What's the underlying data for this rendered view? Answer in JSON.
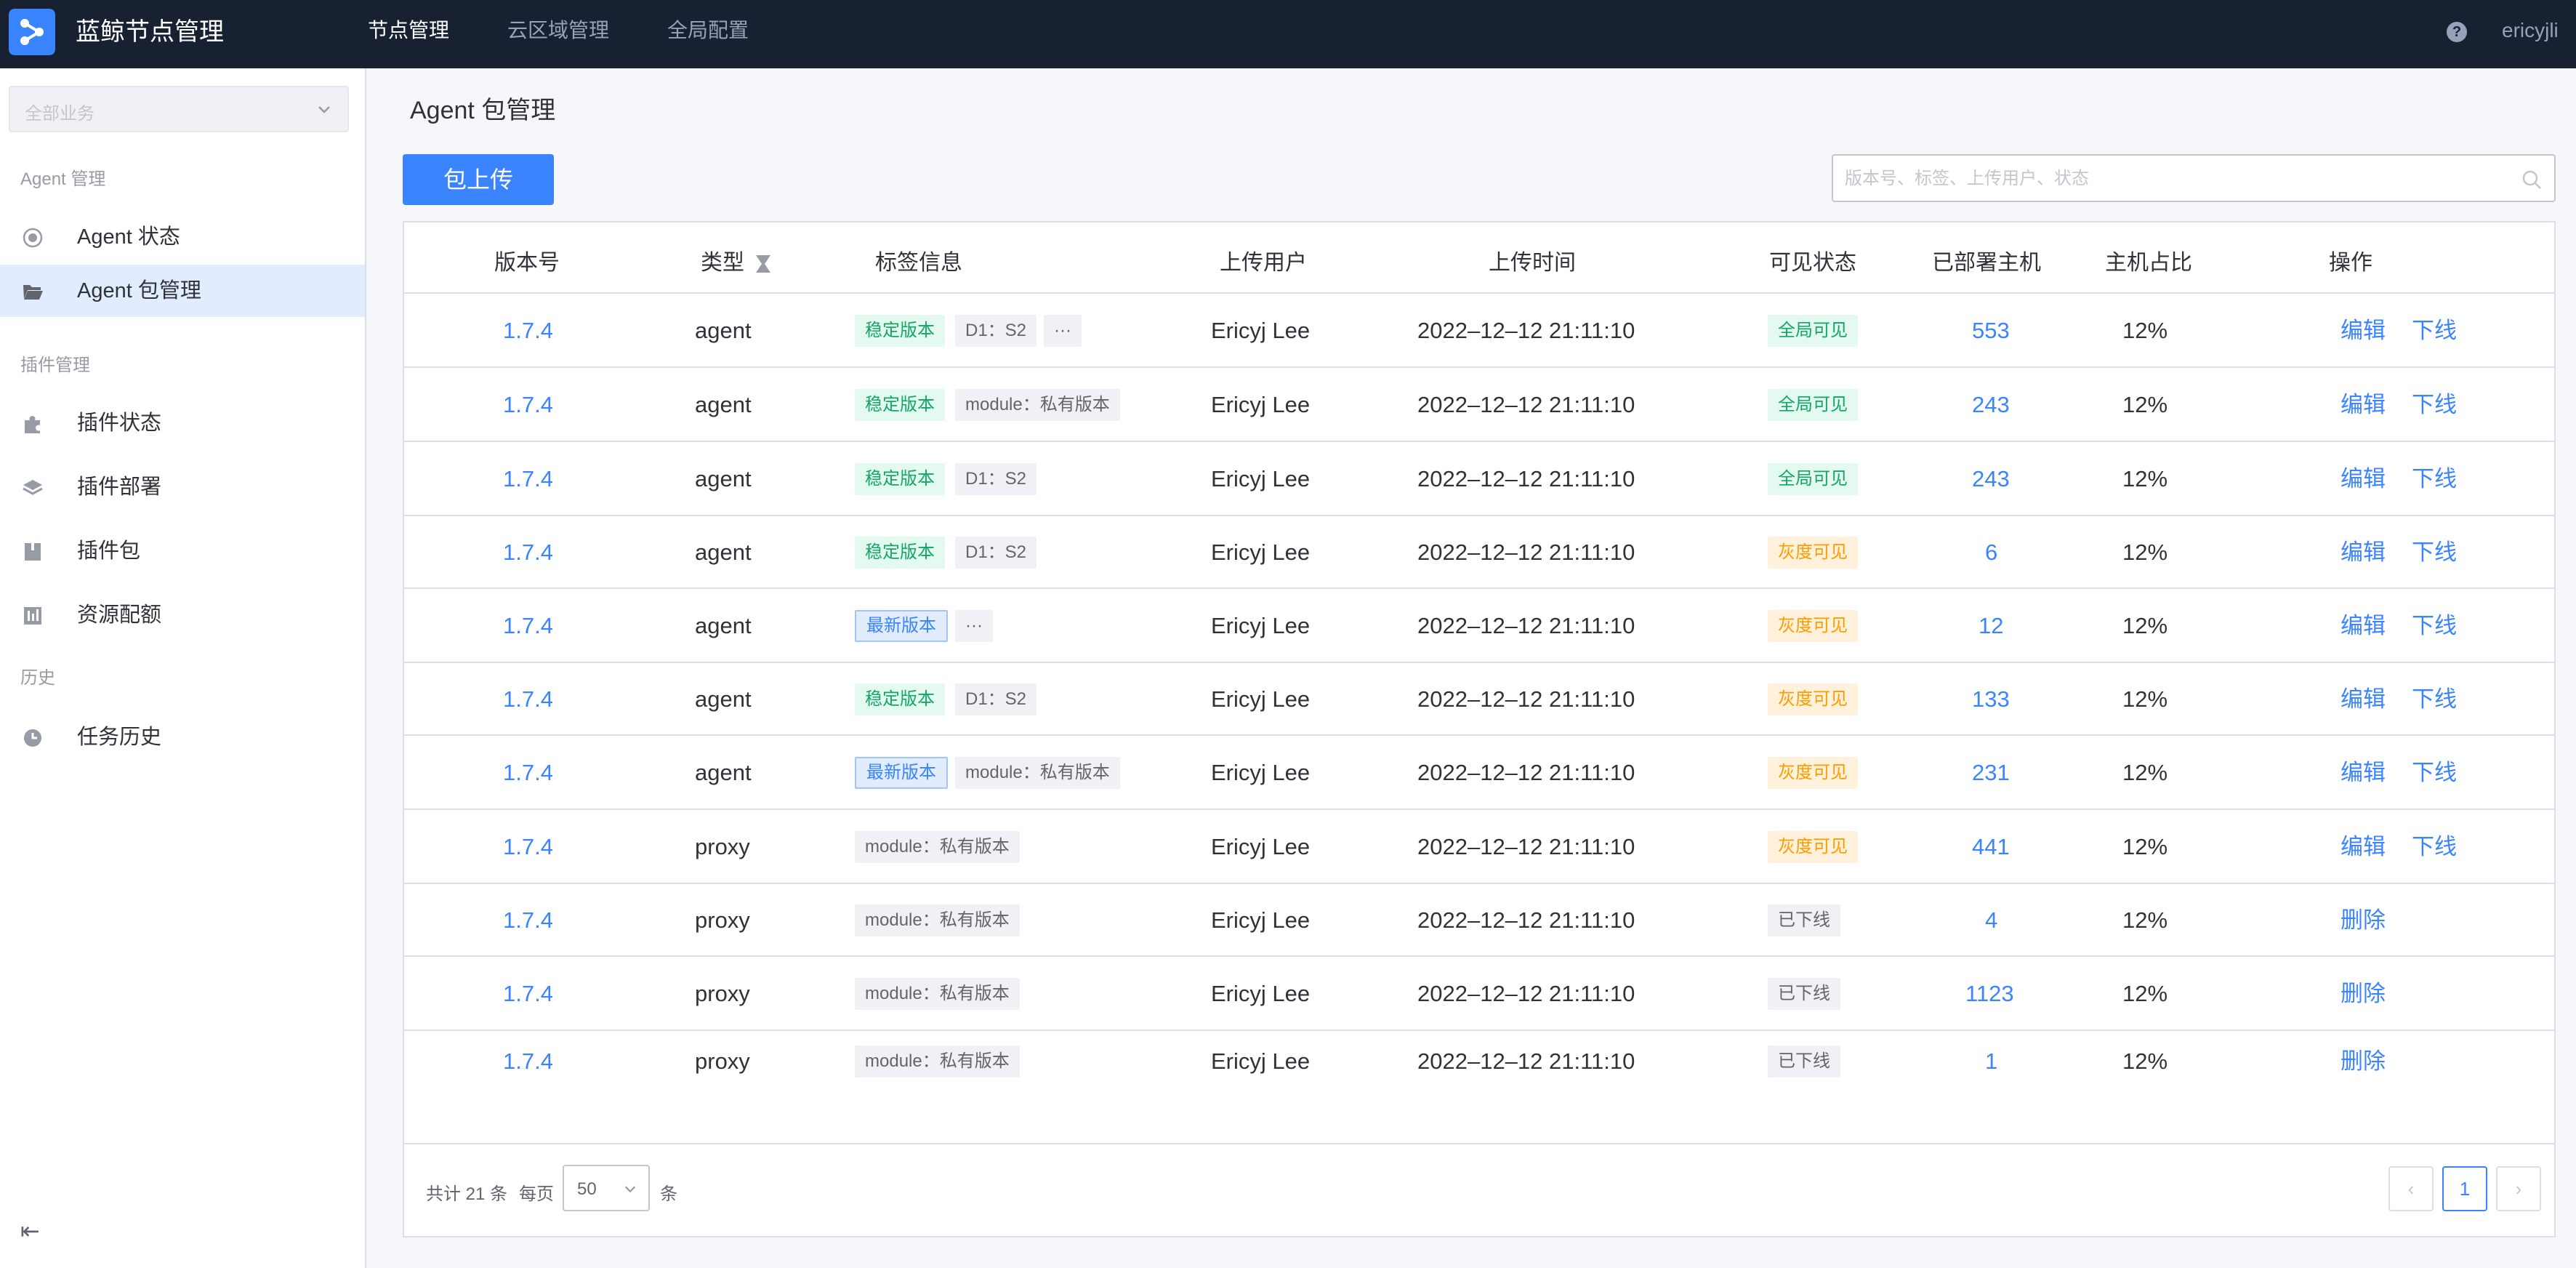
{
  "header": {
    "app_title": "蓝鲸节点管理",
    "nav": [
      "节点管理",
      "云区域管理",
      "全局配置"
    ],
    "username": "ericyjli",
    "help_icon": "help-icon"
  },
  "sidebar": {
    "business_select": "全部业务",
    "groups": [
      {
        "title": "Agent 管理"
      },
      {
        "title": "插件管理"
      },
      {
        "title": "历史"
      }
    ],
    "items": [
      {
        "label": "Agent 状态",
        "icon": "radio-icon"
      },
      {
        "label": "Agent 包管理",
        "icon": "folder-open-icon"
      },
      {
        "label": "插件状态",
        "icon": "puzzle-icon"
      },
      {
        "label": "插件部署",
        "icon": "layers-icon"
      },
      {
        "label": "插件包",
        "icon": "package-icon"
      },
      {
        "label": "资源配额",
        "icon": "quota-icon"
      },
      {
        "label": "任务历史",
        "icon": "clock-icon"
      }
    ]
  },
  "main": {
    "page_title": "Agent 包管理",
    "upload_label": "包上传",
    "search_placeholder": "版本号、标签、上传用户、状态",
    "columns": [
      "版本号",
      "类型",
      "标签信息",
      "上传用户",
      "上传时间",
      "可见状态",
      "已部署主机",
      "主机占比",
      "操作"
    ],
    "rows": [
      {
        "version": "1.7.4",
        "type": "agent",
        "tags": [
          {
            "text": "稳定版本",
            "style": "green"
          },
          {
            "text": "D1：S2",
            "style": "gray"
          },
          {
            "text": "···",
            "style": "gray"
          }
        ],
        "user": "Ericyj Lee",
        "time": "2022–12–12 21:11:10",
        "status": "全局可见",
        "status_style": "green",
        "hosts": "553",
        "ratio": "12%",
        "actions": [
          "编辑",
          "下线"
        ]
      },
      {
        "version": "1.7.4",
        "type": "agent",
        "tags": [
          {
            "text": "稳定版本",
            "style": "green"
          },
          {
            "text": "module：私有版本",
            "style": "gray"
          }
        ],
        "user": "Ericyj Lee",
        "time": "2022–12–12 21:11:10",
        "status": "全局可见",
        "status_style": "green",
        "hosts": "243",
        "ratio": "12%",
        "actions": [
          "编辑",
          "下线"
        ]
      },
      {
        "version": "1.7.4",
        "type": "agent",
        "tags": [
          {
            "text": "稳定版本",
            "style": "green"
          },
          {
            "text": "D1：S2",
            "style": "gray"
          }
        ],
        "user": "Ericyj Lee",
        "time": "2022–12–12 21:11:10",
        "status": "全局可见",
        "status_style": "green",
        "hosts": "243",
        "ratio": "12%",
        "actions": [
          "编辑",
          "下线"
        ]
      },
      {
        "version": "1.7.4",
        "type": "agent",
        "tags": [
          {
            "text": "稳定版本",
            "style": "green"
          },
          {
            "text": "D1：S2",
            "style": "gray"
          }
        ],
        "user": "Ericyj Lee",
        "time": "2022–12–12 21:11:10",
        "status": "灰度可见",
        "status_style": "orange",
        "hosts": "6",
        "ratio": "12%",
        "actions": [
          "编辑",
          "下线"
        ]
      },
      {
        "version": "1.7.4",
        "type": "agent",
        "tags": [
          {
            "text": "最新版本",
            "style": "blue"
          },
          {
            "text": "···",
            "style": "gray"
          }
        ],
        "user": "Ericyj Lee",
        "time": "2022–12–12 21:11:10",
        "status": "灰度可见",
        "status_style": "orange",
        "hosts": "12",
        "ratio": "12%",
        "actions": [
          "编辑",
          "下线"
        ]
      },
      {
        "version": "1.7.4",
        "type": "agent",
        "tags": [
          {
            "text": "稳定版本",
            "style": "green"
          },
          {
            "text": "D1：S2",
            "style": "gray"
          }
        ],
        "user": "Ericyj Lee",
        "time": "2022–12–12 21:11:10",
        "status": "灰度可见",
        "status_style": "orange",
        "hosts": "133",
        "ratio": "12%",
        "actions": [
          "编辑",
          "下线"
        ]
      },
      {
        "version": "1.7.4",
        "type": "agent",
        "tags": [
          {
            "text": "最新版本",
            "style": "blue"
          },
          {
            "text": "module：私有版本",
            "style": "gray"
          }
        ],
        "user": "Ericyj Lee",
        "time": "2022–12–12 21:11:10",
        "status": "灰度可见",
        "status_style": "orange",
        "hosts": "231",
        "ratio": "12%",
        "actions": [
          "编辑",
          "下线"
        ]
      },
      {
        "version": "1.7.4",
        "type": "proxy",
        "tags": [
          {
            "text": "module：私有版本",
            "style": "gray"
          }
        ],
        "user": "Ericyj Lee",
        "time": "2022–12–12 21:11:10",
        "status": "灰度可见",
        "status_style": "orange",
        "hosts": "441",
        "ratio": "12%",
        "actions": [
          "编辑",
          "下线"
        ]
      },
      {
        "version": "1.7.4",
        "type": "proxy",
        "tags": [
          {
            "text": "module：私有版本",
            "style": "gray"
          }
        ],
        "user": "Ericyj Lee",
        "time": "2022–12–12 21:11:10",
        "status": "已下线",
        "status_style": "gray",
        "hosts": "4",
        "ratio": "12%",
        "actions": [
          "删除"
        ]
      },
      {
        "version": "1.7.4",
        "type": "proxy",
        "tags": [
          {
            "text": "module：私有版本",
            "style": "gray"
          }
        ],
        "user": "Ericyj Lee",
        "time": "2022–12–12 21:11:10",
        "status": "已下线",
        "status_style": "gray",
        "hosts": "1123",
        "ratio": "12%",
        "actions": [
          "删除"
        ]
      },
      {
        "version": "1.7.4",
        "type": "proxy",
        "tags": [
          {
            "text": "module：私有版本",
            "style": "gray"
          }
        ],
        "user": "Ericyj Lee",
        "time": "2022–12–12 21:11:10",
        "status": "已下线",
        "status_style": "gray",
        "hosts": "1",
        "ratio": "12%",
        "actions": [
          "删除"
        ]
      }
    ],
    "pagination": {
      "total_text": "共计 21 条",
      "per_page_label": "每页",
      "page_size": "50",
      "unit": "条",
      "current_page": "1",
      "prev_icon": "chevron-left-icon",
      "next_icon": "chevron-right-icon"
    }
  },
  "colors": {
    "topbar": "#182132",
    "primary": "#3a84ff",
    "success": "#14a568",
    "warning": "#fe9c00"
  }
}
